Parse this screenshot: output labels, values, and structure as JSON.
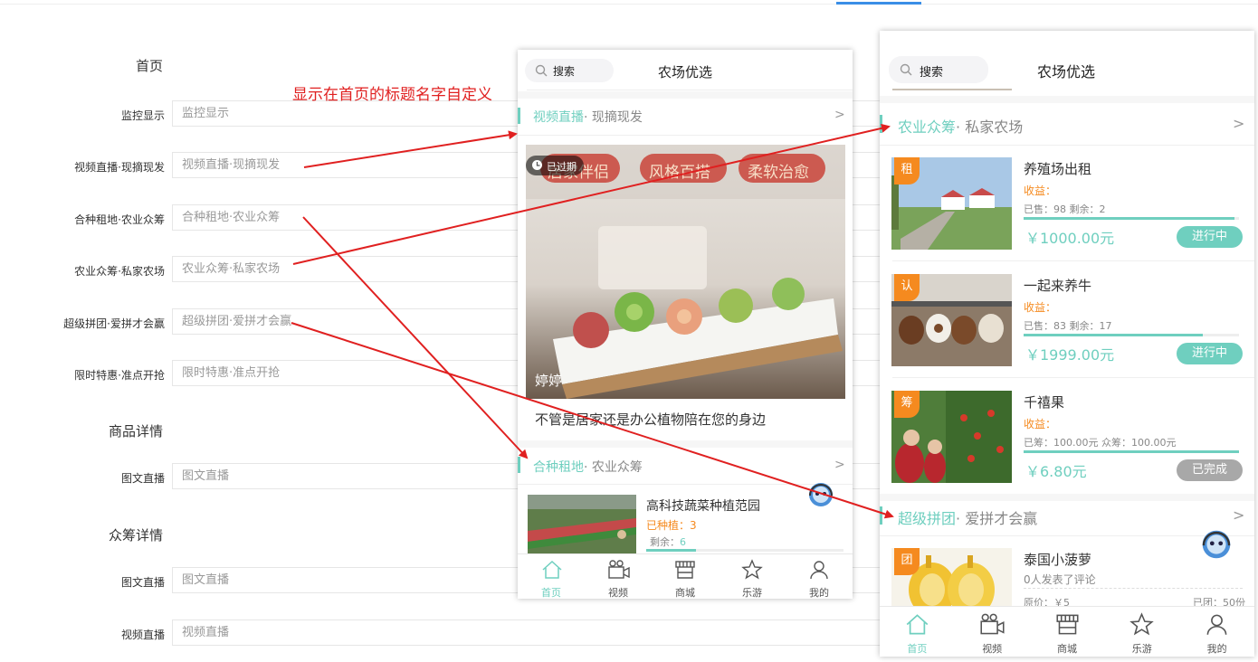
{
  "form": {
    "sections": [
      "首页",
      "商品详情",
      "众筹详情"
    ],
    "rows": [
      {
        "label": "监控显示",
        "placeholder": "监控显示"
      },
      {
        "label": "视频直播·现摘现发",
        "placeholder": "视频直播·现摘现发"
      },
      {
        "label": "合种租地·农业众筹",
        "placeholder": "合种租地·农业众筹"
      },
      {
        "label": "农业众筹·私家农场",
        "placeholder": "农业众筹·私家农场"
      },
      {
        "label": "超级拼团·爱拼才会赢",
        "placeholder": "超级拼团·爱拼才会赢"
      },
      {
        "label": "限时特惠·准点开抢",
        "placeholder": "限时特惠·准点开抢"
      },
      {
        "label": "图文直播",
        "placeholder": "图文直播"
      },
      {
        "label": "图文直播",
        "placeholder": "图文直播"
      },
      {
        "label": "视频直播",
        "placeholder": "视频直播"
      }
    ]
  },
  "annotation": "显示在首页的标题名字自定义",
  "phone1": {
    "search": "搜索",
    "title": "农场优选",
    "section1": {
      "hl": "视频直播",
      "rest": "· 现摘现发"
    },
    "chev": ">",
    "expired": "已过期",
    "banner_words": [
      "居家伴侣",
      "风格百搭",
      "柔软治愈"
    ],
    "author": "婷婷",
    "caption": "不管是居家还是办公植物陪在您的身边",
    "section2": {
      "hl": "合种租地",
      "rest": "· 农业众筹"
    },
    "item": {
      "name": "高科技蔬菜种植范园",
      "planted_label": "已种植：",
      "planted": "3",
      "remain_label": "剩余：",
      "remain": "6"
    },
    "tabs": [
      "首页",
      "视频",
      "商城",
      "乐游",
      "我的"
    ]
  },
  "phone2": {
    "search": "搜索",
    "title": "农场优选",
    "section1": {
      "hl": "农业众筹",
      "rest": "· 私家农场"
    },
    "chev": ">",
    "items": [
      {
        "tag": "租",
        "name": "养殖场出租",
        "income": "收益：",
        "stats": "已售：98 剩余：2",
        "price": "￥1000.00元",
        "btn": "进行中",
        "progress": 0.98,
        "btn_color": "#6fcfbf"
      },
      {
        "tag": "认",
        "name": "一起来养牛",
        "income": "收益：",
        "stats": "已售：83 剩余：17",
        "price": "￥1999.00元",
        "btn": "进行中",
        "progress": 0.83,
        "btn_color": "#6fcfbf"
      },
      {
        "tag": "筹",
        "name": "千禧果",
        "income": "收益：",
        "stats": "已筹：100.00元 众筹：100.00元",
        "price": "￥6.80元",
        "btn": "已完成",
        "progress": 1.0,
        "btn_color": "#a8a8a8"
      }
    ],
    "section2": {
      "hl": "超级拼团",
      "rest": "· 爱拼才会赢"
    },
    "group": {
      "tag": "团",
      "name": "泰国小菠萝",
      "comments": "0人发表了评论",
      "orig": "原价：￥5",
      "sold": "已团：50份"
    },
    "tabs": [
      "首页",
      "视频",
      "商城",
      "乐游",
      "我的"
    ]
  },
  "colors": {
    "accent": "#6fcfbf",
    "tag": "#f58a1f",
    "arrow": "#e02020",
    "income": "#f58a1f"
  }
}
